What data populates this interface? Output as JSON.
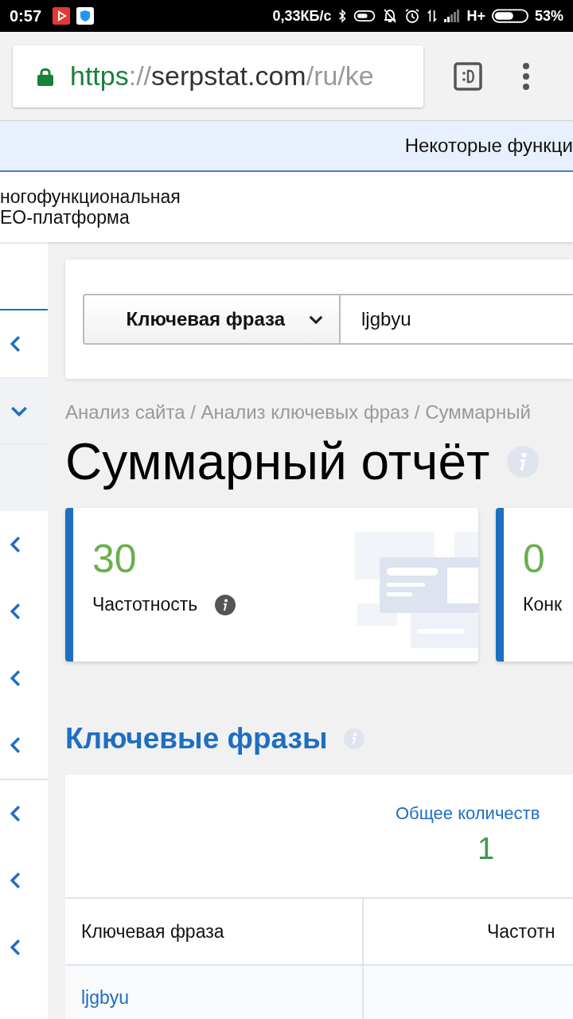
{
  "status_bar": {
    "time": "0:57",
    "speed": "0,33КБ/с",
    "network": "H+",
    "battery": "53%"
  },
  "browser": {
    "url": {
      "scheme": "https",
      "separator": "://",
      "host": "serpstat.com",
      "path": "/ru/ke"
    }
  },
  "banner": {
    "text": "Некоторые функци"
  },
  "header": {
    "tagline": [
      "ногофункциональная",
      "EO-платформа"
    ]
  },
  "sidebar": {
    "groups": [
      {
        "items": [
          {
            "expanded": false
          },
          {
            "expanded": true
          },
          {
            "expanded": false
          },
          {
            "expanded": false
          },
          {
            "expanded": false
          },
          {
            "expanded": false
          }
        ]
      },
      {
        "items": [
          {
            "expanded": false
          },
          {
            "expanded": false
          },
          {
            "expanded": false
          }
        ]
      }
    ]
  },
  "search": {
    "mode": "Ключевая фраза",
    "value": "ljgbyu"
  },
  "breadcrumb": "Анализ сайта / Анализ ключевых фраз / Суммарный",
  "title": "Суммарный отчёт",
  "stats": [
    {
      "value": "30",
      "label": "Частотность"
    },
    {
      "value": "0",
      "label": "Конк"
    }
  ],
  "keywords": {
    "heading": "Ключевые фразы",
    "summary_label": "Общее количеств",
    "summary_value": "1",
    "columns": [
      "Ключевая фраза",
      "Частотн"
    ],
    "rows": [
      [
        "ljgbyu",
        ""
      ]
    ]
  }
}
